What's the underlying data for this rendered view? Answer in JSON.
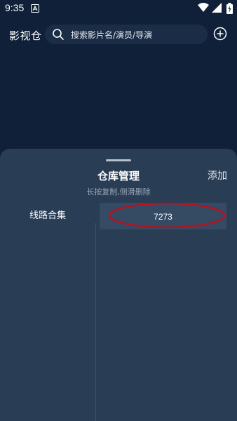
{
  "status_bar": {
    "time": "9:35",
    "icons": [
      "notification-icon",
      "wifi-icon",
      "signal-icon",
      "battery-icon"
    ]
  },
  "header": {
    "app_title": "影视仓",
    "search_placeholder": "搜索影片名/演员/导演",
    "icons": [
      "search-icon",
      "add-circle-icon"
    ]
  },
  "sheet": {
    "title": "仓库管理",
    "add_label": "添加",
    "subtitle": "长按复制,侧滑删除",
    "left_items": [
      {
        "label": "线路合集"
      }
    ],
    "right_items": [
      {
        "label": "7273"
      }
    ]
  },
  "colors": {
    "background": "#0f2038",
    "sheet_background": "#293d55",
    "search_background": "#1b2d46",
    "item_background": "#354a63",
    "annotation_circle": "#b51222"
  }
}
